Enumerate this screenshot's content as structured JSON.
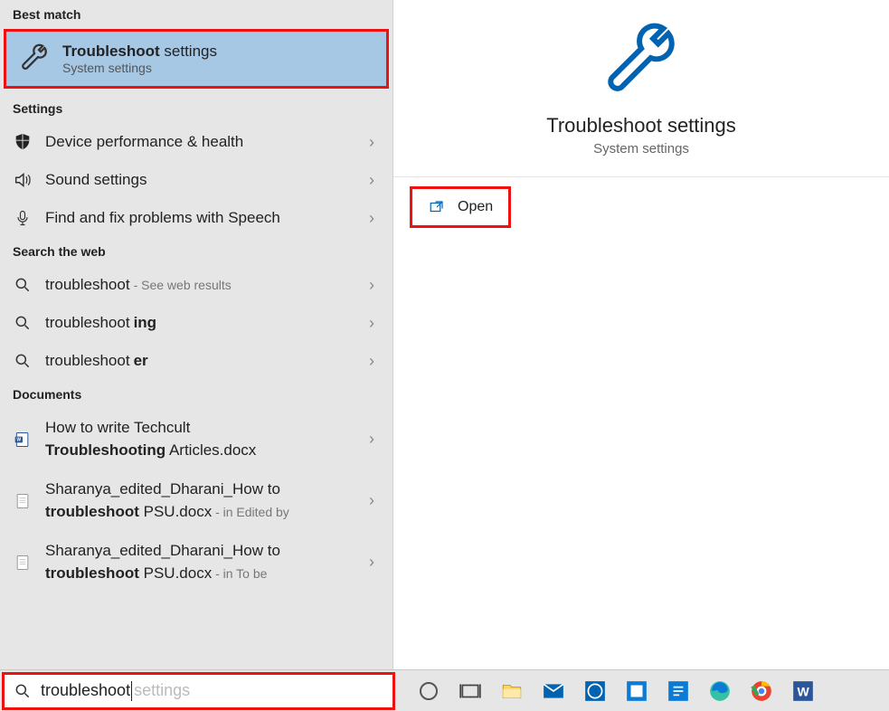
{
  "left": {
    "bestMatchHdr": "Best match",
    "best": {
      "titlePrefix": "Troubleshoot",
      "titleRest": " settings",
      "sub": "System settings"
    },
    "settingsHdr": "Settings",
    "settings": [
      {
        "label": "Device performance & health"
      },
      {
        "label": "Sound settings"
      },
      {
        "label": "Find and fix problems with Speech"
      }
    ],
    "webHdr": "Search the web",
    "web": [
      {
        "bold": "troubleshoot",
        "rest": "",
        "trail": " - See web results"
      },
      {
        "bold": "ing",
        "prefix": "troubleshoot"
      },
      {
        "bold": "er",
        "prefix": "troubleshoot"
      }
    ],
    "docsHdr": "Documents",
    "docs": [
      {
        "l1a": "How to write Techcult",
        "l2b": "Troubleshooting",
        "l2r": " Articles.docx"
      },
      {
        "l1a": "Sharanya_edited_Dharani_How to",
        "l2b": "troubleshoot",
        "l2r": " PSU.docx",
        "trail": " - in Edited by"
      },
      {
        "l1a": "Sharanya_edited_Dharani_How to",
        "l2b": "troubleshoot",
        "l2r": " PSU.docx",
        "trail": " - in To be"
      }
    ]
  },
  "right": {
    "title": "Troubleshoot settings",
    "sub": "System settings",
    "open": "Open"
  },
  "search": {
    "typed": "troubleshoot",
    "ghost": " settings"
  }
}
